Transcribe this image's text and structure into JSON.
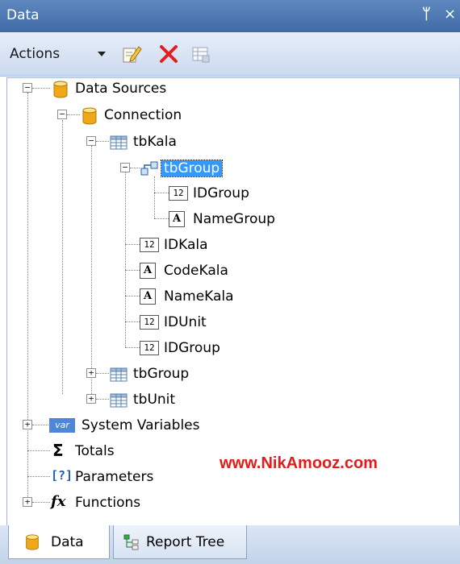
{
  "title_bar": {
    "title": "Data",
    "pin_glyph": "ᛘ",
    "close_glyph": "×"
  },
  "toolbar": {
    "actions_label": "Actions",
    "icons": [
      "edit-icon",
      "delete-icon",
      "grid-properties-icon"
    ]
  },
  "tree": {
    "data_sources": "Data Sources",
    "connection": "Connection",
    "tbkala": "tbKala",
    "tbgroup_relation": "tbGroup",
    "idgroup_rel": "IDGroup",
    "namegroup": "NameGroup",
    "idkala": "IDKala",
    "codekala": "CodeKala",
    "namekala": "NameKala",
    "idunit": "IDUnit",
    "idgroup": "IDGroup",
    "tbgroup": "tbGroup",
    "tbunit": "tbUnit",
    "system_variables": "System Variables",
    "totals": "Totals",
    "parameters": "Parameters",
    "functions": "Functions",
    "num_badge": "12",
    "text_badge": "A",
    "var_badge": "var",
    "sum_glyph": "Σ",
    "param_glyph": "[?]",
    "fx_glyph": "fx",
    "expanded_glyph": "−",
    "collapsed_glyph": "+"
  },
  "watermark": "www.NikAmooz.com",
  "tabs": [
    {
      "label": "Data"
    },
    {
      "label": "Report Tree"
    }
  ],
  "colors": {
    "title_bar": "#4a76b0",
    "selection": "#3399ff",
    "watermark": "#e31b1b",
    "db_icon": "#f0a818",
    "delete_icon": "#e02020"
  }
}
